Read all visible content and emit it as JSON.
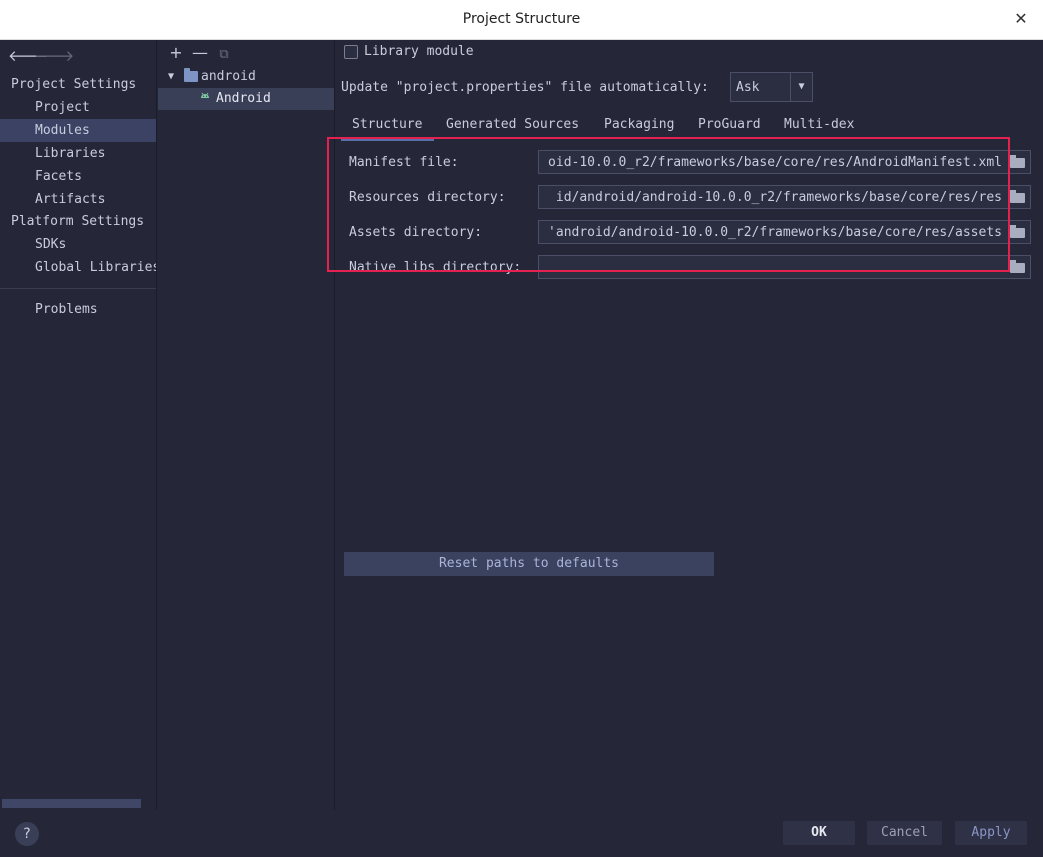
{
  "window": {
    "title": "Project Structure",
    "close_glyph": "✕"
  },
  "nav": {
    "back_glyph": "🡐",
    "forward_glyph": "🡒"
  },
  "sidebar": {
    "project_settings_heading": "Project Settings",
    "project_items": [
      {
        "label": "Project"
      },
      {
        "label": "Modules"
      },
      {
        "label": "Libraries"
      },
      {
        "label": "Facets"
      },
      {
        "label": "Artifacts"
      }
    ],
    "platform_settings_heading": "Platform Settings",
    "platform_items": [
      {
        "label": "SDKs"
      },
      {
        "label": "Global Libraries"
      }
    ],
    "problems_label": "Problems",
    "selected": "Modules"
  },
  "tree": {
    "add_glyph": "+",
    "remove_glyph": "—",
    "copy_glyph": "⧉",
    "parent_label": "android",
    "child_label": "Android",
    "child_icon": "🤖"
  },
  "main": {
    "library_module_label": "Library module",
    "library_module_checked": false,
    "update_label": "Update \"project.properties\" file automatically:",
    "update_value": "Ask",
    "dropdown_glyph": "▼",
    "tabs": [
      {
        "label": "Structure"
      },
      {
        "label": "Generated Sources"
      },
      {
        "label": "Packaging"
      },
      {
        "label": "ProGuard"
      },
      {
        "label": "Multi-dex"
      }
    ],
    "active_tab": "Structure",
    "fields": [
      {
        "label": "Manifest file:",
        "value": "oid-10.0.0_r2/frameworks/base/core/res/AndroidManifest.xml"
      },
      {
        "label": "Resources directory:",
        "value": "id/android/android-10.0.0_r2/frameworks/base/core/res/res"
      },
      {
        "label": "Assets directory:",
        "value": "'android/android-10.0.0_r2/frameworks/base/core/res/assets"
      },
      {
        "label": "Native libs directory:",
        "value": ""
      }
    ],
    "reset_button": "Reset paths to defaults"
  },
  "footer": {
    "help_glyph": "?",
    "ok": "OK",
    "cancel": "Cancel",
    "apply": "Apply"
  },
  "colors": {
    "background": "#252738",
    "selection": "#3b4263",
    "highlight_border": "#e3224f",
    "android_green": "#7ec9a5"
  }
}
